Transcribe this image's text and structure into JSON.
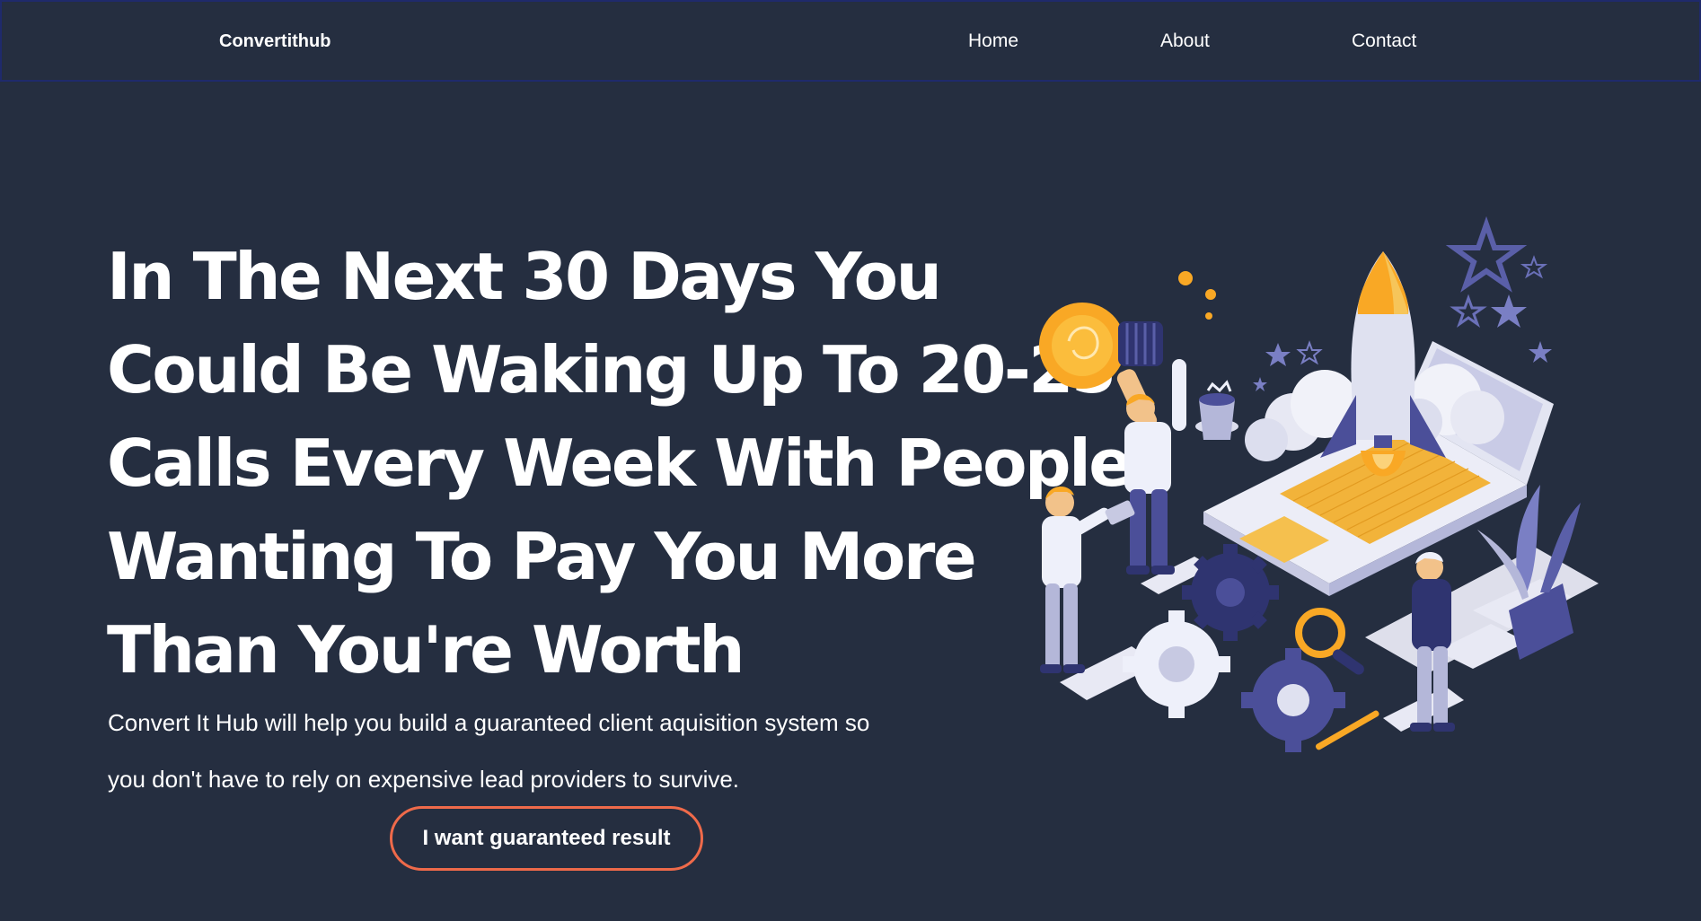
{
  "nav": {
    "brand": "Convertithub",
    "links": [
      "Home",
      "About",
      "Contact"
    ]
  },
  "hero": {
    "title_lines": [
      "In The Next 30 Days You",
      "Could Be Waking Up To 20-25",
      "Calls Every Week With People",
      "Wanting To Pay You More",
      "Than You're Worth"
    ],
    "subtitle_lines": [
      "Convert It Hub will help you build a guaranteed client aquisition system so",
      "you don't have to rely on expensive lead providers to survive."
    ],
    "cta_label": "I want guaranteed result"
  },
  "illustration": {
    "icon": "startup-rocket-illustration",
    "colors": {
      "background": "#252e40",
      "accent_orange": "#f9a825",
      "accent_purple": "#4b4f99",
      "light": "#e3e5f2",
      "button_border": "#ef6a4a"
    }
  }
}
